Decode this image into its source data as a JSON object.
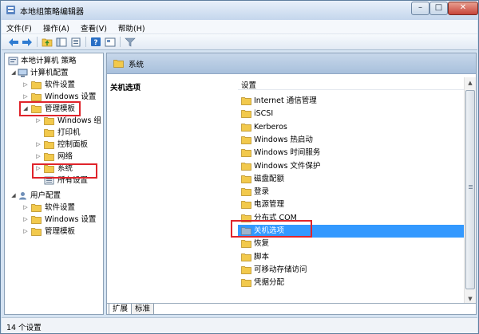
{
  "window": {
    "title": "本地组策略编辑器",
    "min_label": "–",
    "max_label": "□",
    "close_label": "✕"
  },
  "menu": [
    "文件(F)",
    "操作(A)",
    "查看(V)",
    "帮助(H)"
  ],
  "toolbar_icons": [
    "back-arrow-icon",
    "forward-arrow-icon",
    "up-folder-icon",
    "show-hide-tree-icon",
    "export-list-icon",
    "help-icon",
    "properties-icon",
    "filter-icon"
  ],
  "tree": [
    {
      "label": "本地计算机 策略",
      "icon": "policy-icon"
    },
    {
      "label": "计算机配置",
      "icon": "computer-icon"
    },
    {
      "label": "软件设置",
      "icon": "folder-icon"
    },
    {
      "label": "Windows 设置",
      "icon": "folder-icon"
    },
    {
      "label": "管理模板",
      "icon": "folder-icon"
    },
    {
      "label": "Windows 组",
      "icon": "folder-icon"
    },
    {
      "label": "打印机",
      "icon": "folder-icon"
    },
    {
      "label": "控制面板",
      "icon": "folder-icon"
    },
    {
      "label": "网络",
      "icon": "folder-icon"
    },
    {
      "label": "系统",
      "icon": "folder-icon"
    },
    {
      "label": "所有设置",
      "icon": "settings-icon"
    },
    {
      "label": "用户配置",
      "icon": "user-icon"
    },
    {
      "label": "软件设置",
      "icon": "folder-icon"
    },
    {
      "label": "Windows 设置",
      "icon": "folder-icon"
    },
    {
      "label": "管理模板",
      "icon": "folder-icon"
    }
  ],
  "right": {
    "banner_title": "系统",
    "left_column_title": "关机选项",
    "list_header": "设置",
    "items": [
      "Internet 通信管理",
      "iSCSI",
      "Kerberos",
      "Windows 热启动",
      "Windows 时间服务",
      "Windows 文件保护",
      "磁盘配额",
      "登录",
      "电源管理",
      "分布式 COM",
      "关机选项",
      "恢复",
      "脚本",
      "可移动存储访问",
      "凭据分配"
    ],
    "selected_index": 10
  },
  "tabs": [
    "扩展",
    "标准"
  ],
  "status": "14 个设置",
  "colors": {
    "highlight": "#e0242b",
    "selection": "#3399ff",
    "folder": "#f2c94c"
  }
}
